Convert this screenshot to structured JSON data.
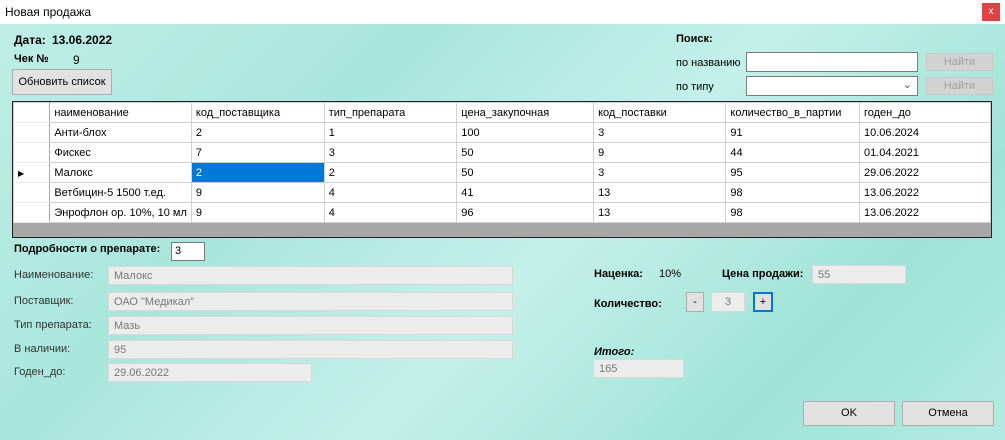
{
  "window": {
    "title": "Новая продажа",
    "close": "x"
  },
  "header": {
    "date_label": "Дата:",
    "date_value": "13.06.2022",
    "check_label": "Чек №",
    "check_value": "9",
    "refresh_button": "Обновить список"
  },
  "search": {
    "title": "Поиск:",
    "by_name_label": "по названию",
    "by_name_value": "",
    "by_type_label": "по типу",
    "by_type_value": "",
    "find_button": "Найти"
  },
  "table": {
    "columns": [
      "наименование",
      "код_поставщика",
      "тип_препарата",
      "цена_закупочная",
      "код_поставки",
      "количество_в_партии",
      "годен_до"
    ],
    "rows": [
      [
        "Анти-блох",
        "2",
        "1",
        "100",
        "3",
        "91",
        "10.06.2024"
      ],
      [
        "Фискес",
        "7",
        "3",
        "50",
        "9",
        "44",
        "01.04.2021"
      ],
      [
        "Малокс",
        "2",
        "2",
        "50",
        "3",
        "95",
        "29.06.2022"
      ],
      [
        "Ветбицин-5 1500 т.ед.",
        "9",
        "4",
        "41",
        "13",
        "98",
        "13.06.2022"
      ],
      [
        "Энрофлон ор. 10%, 10 мл",
        "9",
        "4",
        "96",
        "13",
        "98",
        "13.06.2022"
      ]
    ],
    "selected_row": 2,
    "selected_col": 1,
    "current_row_marker": "▶"
  },
  "details": {
    "title": "Подробности о препарате:",
    "id_value": "3",
    "fields": [
      {
        "label": "Наименование:",
        "value": "Малокс"
      },
      {
        "label": "Поставщик:",
        "value": "ОАО \"Медикал\""
      },
      {
        "label": "Тип препарата:",
        "value": "Мазь"
      },
      {
        "label": "В наличии:",
        "value": "95"
      },
      {
        "label": "Годен_до:",
        "value": "29.06.2022"
      }
    ]
  },
  "sale": {
    "markup_label": "Наценка:",
    "markup_value": "10%",
    "price_label": "Цена продажи:",
    "price_value": "55",
    "qty_label": "Количество:",
    "minus": "-",
    "qty_value": "3",
    "plus": "+",
    "total_label": "Итого:",
    "total_value": "165"
  },
  "buttons": {
    "ok": "OK",
    "cancel": "Отмена"
  }
}
